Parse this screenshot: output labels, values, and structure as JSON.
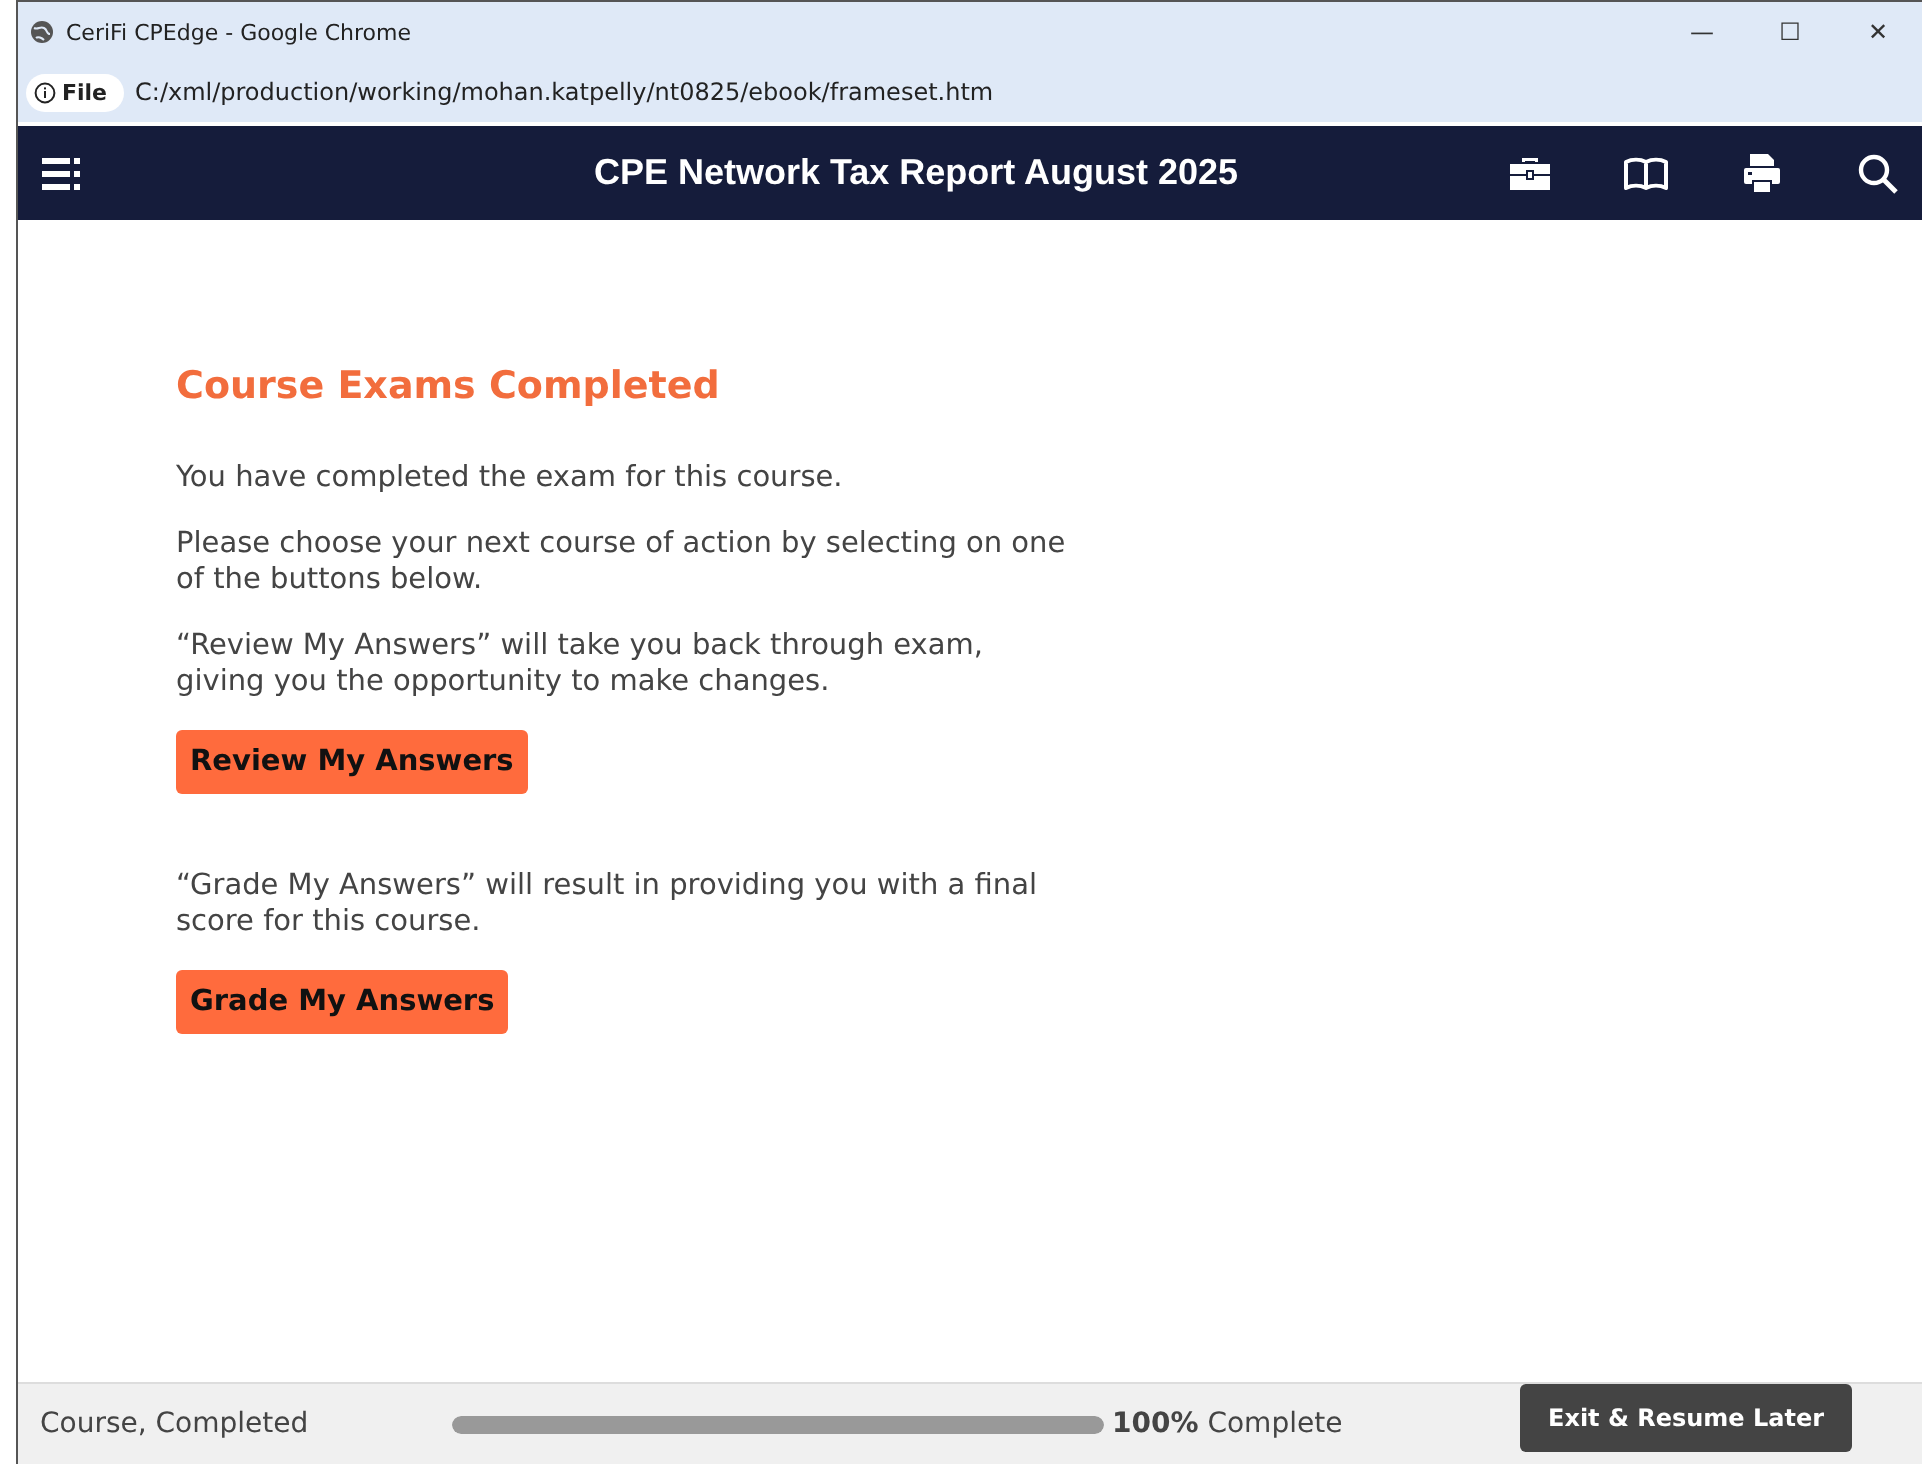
{
  "window": {
    "title": "CeriFi CPEdge - Google Chrome",
    "controls": [
      "—",
      "☐",
      "✕"
    ]
  },
  "address_bar": {
    "scheme": "File",
    "url": "C:/xml/production/working/mohan.katpelly/nt0825/ebook/frameset.htm"
  },
  "header": {
    "title": "CPE Network Tax Report August 2025"
  },
  "content": {
    "heading": "Course Exams Completed",
    "blocks": [
      {
        "kind": "text",
        "text": "You have completed the exam for this course."
      },
      {
        "kind": "text",
        "text": "Please choose your next course of action by selecting on one of the buttons below."
      },
      {
        "kind": "text",
        "text": "“Review My Answers” will take you back through exam, giving you the opportunity to make changes."
      },
      {
        "kind": "button",
        "text": "Review My Answers"
      },
      {
        "kind": "text",
        "text": "“Grade My Answers” will result in providing you with a final score for this course."
      },
      {
        "kind": "button",
        "text": "Grade My Answers"
      }
    ]
  },
  "footer": {
    "status": "Course, Completed",
    "progress": {
      "level": 1,
      "reading": "**100%** Complete"
    },
    "exit_button": "Exit & Resume Later"
  }
}
